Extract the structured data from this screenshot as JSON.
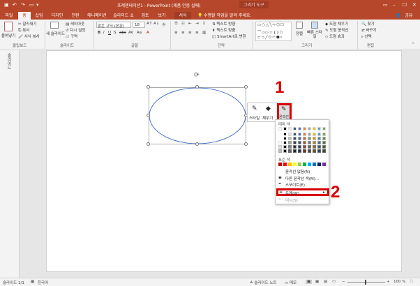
{
  "titlebar": {
    "title": "프레젠테이션1 - PowerPoint (제품 인증 실패)",
    "context_tab": "그리기 도구"
  },
  "tabs": [
    {
      "label": "파일"
    },
    {
      "label": "홈"
    },
    {
      "label": "삽입"
    },
    {
      "label": "디자인"
    },
    {
      "label": "전환"
    },
    {
      "label": "애니메이션"
    },
    {
      "label": "슬라이드 쇼"
    },
    {
      "label": "검토"
    },
    {
      "label": "보기"
    },
    {
      "label": "서식"
    }
  ],
  "tell_me": "수행할 작업을 알려 주세요.",
  "share": "공유",
  "ribbon": {
    "clipboard": {
      "paste": "붙여넣기",
      "cut": "잘라내기",
      "copy": "복사",
      "format_painter": "서식 복사",
      "group": "클립보드"
    },
    "slides": {
      "new_slide": "새 슬라이드",
      "layout": "레이아웃",
      "reset": "다시 설정",
      "section": "구역",
      "group": "슬라이드"
    },
    "font": {
      "font_name": "맑은 고딕 (본문)",
      "font_size": "18",
      "group": "글꼴"
    },
    "paragraph": {
      "text_direction": "텍스트 방향",
      "align_text": "텍스트 맞춤",
      "smartart": "SmartArt로 변환",
      "group": "단락"
    },
    "drawing": {
      "arrange": "정렬",
      "quick_styles": "빠른 스타일",
      "shape_fill": "도형 채우기",
      "shape_outline": "도형 윤곽선",
      "shape_effects": "도형 효과",
      "group": "그리기"
    },
    "editing": {
      "find": "찾기",
      "replace": "바꾸기",
      "select": "선택",
      "group": "편집"
    }
  },
  "left_pane": {
    "label": "슬라이드"
  },
  "mini_toolbar": {
    "style": "스타일",
    "fill": "채우기",
    "outline": "윤곽선"
  },
  "dropdown": {
    "theme_colors": "테마 색",
    "standard_colors": "표준 색",
    "no_outline": "윤곽선 없음(N)",
    "more_colors": "다른 윤곽선 색(M)...",
    "eyedropper": "스포이트(E)",
    "weight": "두께(W)",
    "dashes": "대시(S)"
  },
  "callouts": {
    "one": "1",
    "two": "2"
  },
  "status": {
    "slide": "슬라이드 1/1",
    "language": "한국어",
    "notes": "슬라이드 노트",
    "comments": "메모",
    "zoom": "100 %"
  },
  "colors": {
    "accent": "#b7472a",
    "highlight": "#d70000",
    "ellipse": "#4472c4"
  }
}
